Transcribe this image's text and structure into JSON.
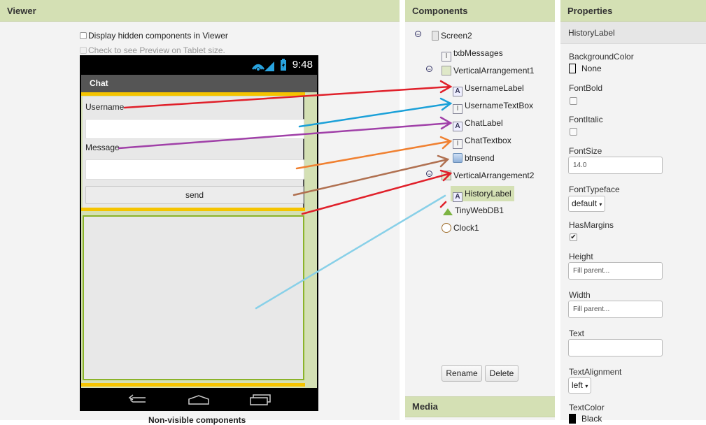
{
  "viewer": {
    "title": "Viewer",
    "display_hidden": "Display hidden components in Viewer",
    "tablet_preview": "Check to see Preview on Tablet size.",
    "phone": {
      "time": "9:48",
      "title": "Chat",
      "username_label": "Username",
      "message_label": "Message",
      "send_button": "send"
    },
    "non_visible": "Non-visible components"
  },
  "components": {
    "title": "Components",
    "tree": [
      {
        "label": "Screen2",
        "icon": "screen-icon"
      },
      {
        "label": "txbMessages",
        "icon": "textbox-icon"
      },
      {
        "label": "VerticalArrangement1",
        "icon": "arrangement-icon"
      },
      {
        "label": "UsernameLabel",
        "icon": "label-icon"
      },
      {
        "label": "UsernameTextBox",
        "icon": "textbox-icon"
      },
      {
        "label": "ChatLabel",
        "icon": "label-icon"
      },
      {
        "label": "ChatTextbox",
        "icon": "textbox-icon"
      },
      {
        "label": "btnsend",
        "icon": "button-icon"
      },
      {
        "label": "VerticalArrangement2",
        "icon": "arrangement-icon"
      },
      {
        "label": "HistoryLabel",
        "icon": "label-icon"
      },
      {
        "label": "TinyWebDB1",
        "icon": "database-icon"
      },
      {
        "label": "Clock1",
        "icon": "clock-icon"
      }
    ],
    "rename": "Rename",
    "delete": "Delete",
    "media_title": "Media"
  },
  "properties": {
    "title": "Properties",
    "component": "HistoryLabel",
    "background_color_label": "BackgroundColor",
    "background_color_value": "None",
    "font_bold_label": "FontBold",
    "font_italic_label": "FontItalic",
    "font_size_label": "FontSize",
    "font_size_value": "14.0",
    "font_typeface_label": "FontTypeface",
    "font_typeface_value": "default",
    "has_margins_label": "HasMargins",
    "height_label": "Height",
    "height_value": "Fill parent...",
    "width_label": "Width",
    "width_value": "Fill parent...",
    "text_label": "Text",
    "text_value": "",
    "text_alignment_label": "TextAlignment",
    "text_alignment_value": "left",
    "text_color_label": "TextColor",
    "text_color_value": "Black"
  },
  "colors": {
    "header_bg": "#d4e0b4",
    "accent_yellow": "#f5c400",
    "arrangement_border": "#8bb32a",
    "arrow_red": "#e0202a",
    "arrow_blue": "#1aa0d8",
    "arrow_purple": "#a040a8",
    "arrow_orange": "#f08030",
    "arrow_brown": "#b07050",
    "arrow_lightblue": "#88d0e8"
  }
}
